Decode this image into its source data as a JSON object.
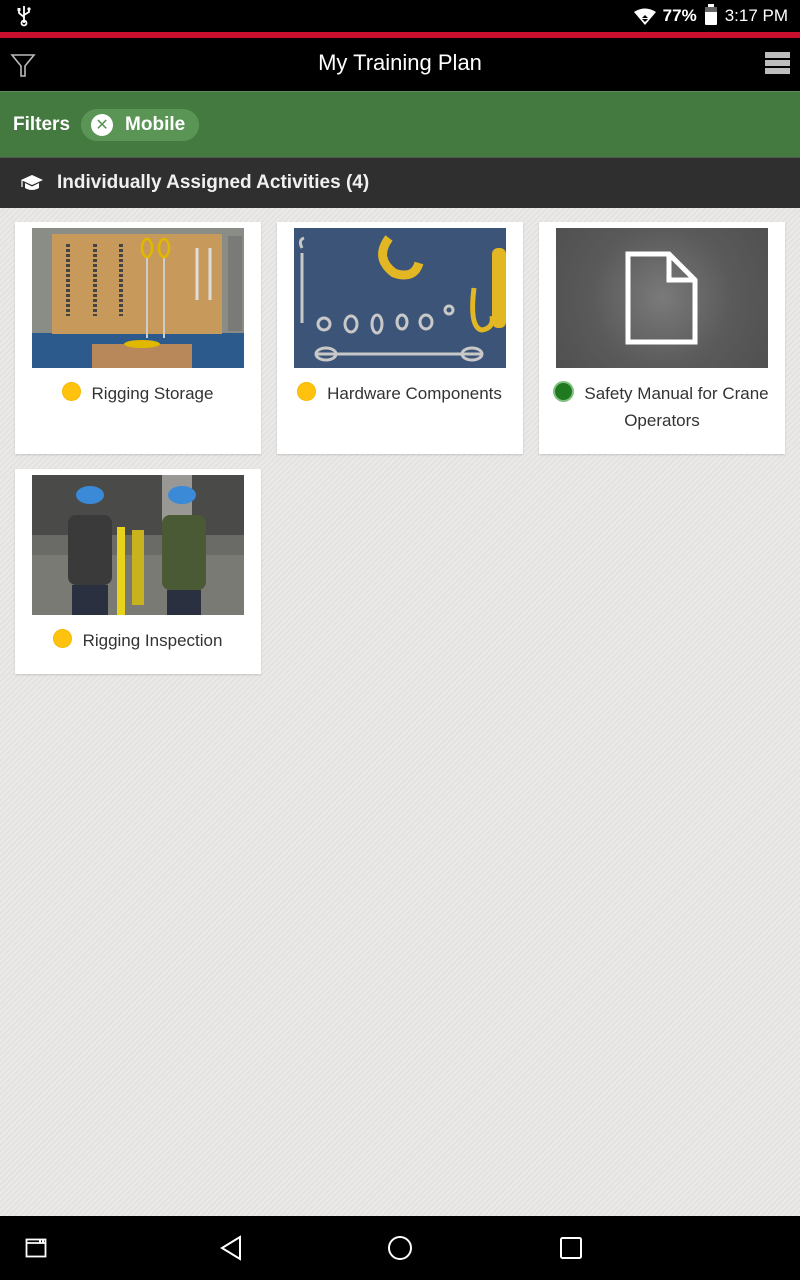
{
  "status_bar": {
    "battery_percent": "77%",
    "time": "3:17 PM",
    "icons": [
      "usb-icon",
      "wifi-icon",
      "battery-charging-icon"
    ]
  },
  "app_bar": {
    "title": "My Training Plan",
    "left_icon": "filter-icon",
    "right_icon": "menu-icon"
  },
  "filters": {
    "label": "Filters",
    "chips": [
      {
        "label": "Mobile",
        "icon": "remove-icon"
      }
    ]
  },
  "section": {
    "icon": "graduation-cap-icon",
    "title": "Individually Assigned Activities (4)"
  },
  "activities": [
    {
      "title": "Rigging Storage",
      "status": "in-progress",
      "status_color": "#ffc20e",
      "thumbnail": "rigging-storage-image"
    },
    {
      "title": "Hardware Components",
      "status": "in-progress",
      "status_color": "#ffc20e",
      "thumbnail": "hardware-components-image"
    },
    {
      "title": "Safety Manual for Crane Operators",
      "status": "completed",
      "status_color": "#1f7a1f",
      "thumbnail": "document-icon"
    },
    {
      "title": "Rigging Inspection",
      "status": "in-progress",
      "status_color": "#ffc20e",
      "thumbnail": "rigging-inspection-image"
    }
  ],
  "nav_bar": {
    "buttons": [
      "screenshot-icon",
      "back-icon",
      "home-icon",
      "recents-icon"
    ]
  },
  "colors": {
    "accent_red": "#c8102e",
    "filters_green": "#447a40",
    "header_dark": "#2f2f2f"
  }
}
